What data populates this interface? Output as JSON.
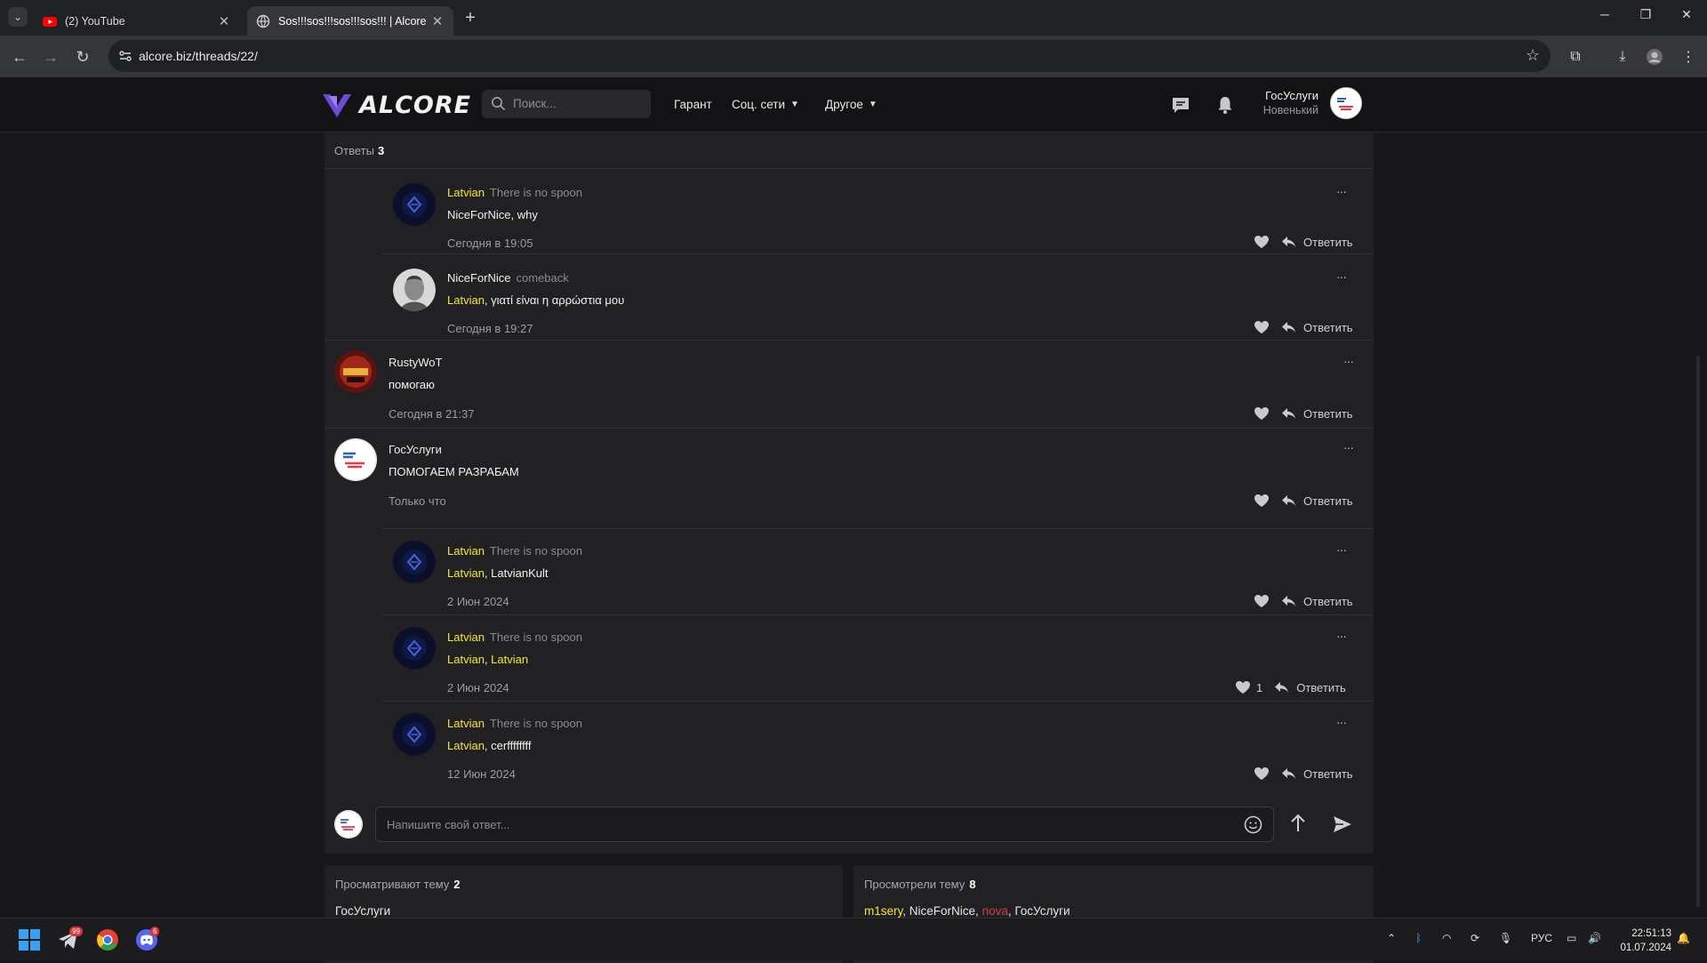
{
  "browser": {
    "tabs": [
      {
        "title": "(2) YouTube",
        "active": false
      },
      {
        "title": "Sos!!!sos!!!sos!!!sos!!! | Alcore",
        "active": true
      }
    ],
    "url": "alcore.biz/threads/22/"
  },
  "site": {
    "logo_text": "ALCORE",
    "search_placeholder": "Поиск...",
    "nav": [
      {
        "label": "Гарант"
      },
      {
        "label": "Соц. сети"
      },
      {
        "label": "Другое"
      }
    ],
    "user": {
      "name": "ГосУслуги",
      "rank": "Новенький"
    }
  },
  "thread": {
    "replies_label": "Ответы",
    "replies_count": "3",
    "posts": [
      {
        "kind": "nested",
        "author": "Latvian",
        "status": "There is no spoon",
        "mention": "",
        "text_html_parts": [
          "NiceForNice",
          ", why"
        ],
        "date": "Сегодня в 19:05",
        "likes": ""
      },
      {
        "kind": "nested",
        "author": "NiceForNice",
        "status": "comeback",
        "text_html_parts": [
          "Latvian",
          ", γιατί είναι η αρρώστια μου"
        ],
        "date": "Сегодня в 19:27",
        "likes": ""
      },
      {
        "kind": "top",
        "author": "RustyWoT",
        "status": "",
        "text": "помогаю",
        "date": "Сегодня в 21:37",
        "likes": ""
      },
      {
        "kind": "top",
        "author": "ГосУслуги",
        "status": "",
        "text": "ПОМОГАЕМ РАЗРАБАМ",
        "date": "Только что",
        "likes": ""
      },
      {
        "kind": "nested",
        "author": "Latvian",
        "status": "There is no spoon",
        "text_html_parts": [
          "Latvian",
          ", LatvianKult"
        ],
        "date": "2 Июн 2024",
        "likes": ""
      },
      {
        "kind": "nested",
        "author": "Latvian",
        "status": "There is no spoon",
        "text_html_parts": [
          "Latvian",
          ", ",
          "Latvian"
        ],
        "date": "2 Июн 2024",
        "likes": "1"
      },
      {
        "kind": "nested",
        "author": "Latvian",
        "status": "There is no spoon",
        "text_html_parts": [
          "Latvian",
          ", cerffffffff"
        ],
        "date": "12 Июн 2024",
        "likes": ""
      }
    ],
    "reply_label": "Ответить",
    "more_label": "···"
  },
  "composer": {
    "placeholder": "Напишите свой ответ..."
  },
  "viewing": {
    "label": "Просматривают тему",
    "count": "2",
    "users": "ГосУслуги"
  },
  "viewed": {
    "label": "Просмотрели тему",
    "count": "8",
    "users": [
      {
        "name": "m1sery",
        "color": "yellow"
      },
      {
        "name": "NiceForNice",
        "color": "white"
      },
      {
        "name": "nova",
        "color": "red"
      },
      {
        "name": "ГосУслуги",
        "color": "white"
      }
    ],
    "separator": ", "
  },
  "taskbar": {
    "badges": {
      "telegram": "99",
      "discord": "6"
    },
    "lang": "РУС",
    "time": "22:51:13",
    "date": "01.07.2024"
  },
  "colors": {
    "accent_yellow": "#f5e43a",
    "red_user": "#d23b4a",
    "bg": "#18181a",
    "panel": "#212124"
  }
}
